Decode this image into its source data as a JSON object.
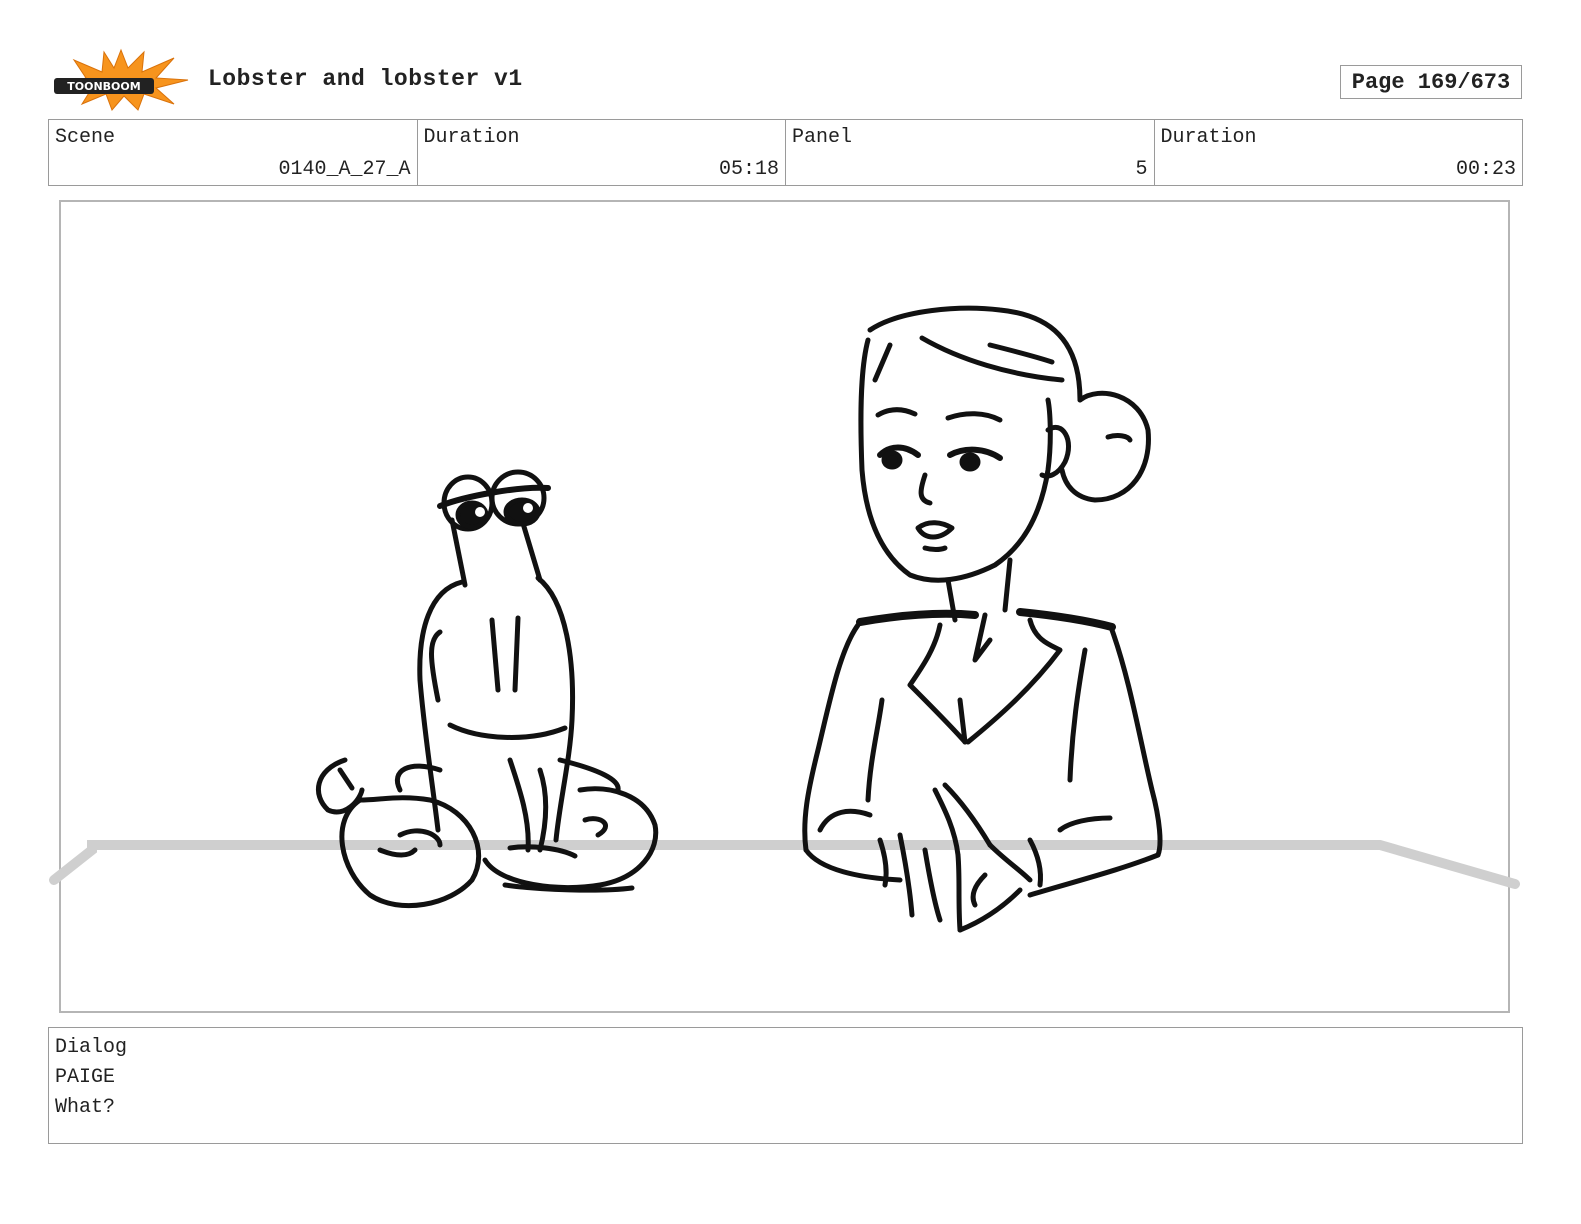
{
  "header": {
    "logo": {
      "icon": "toonboom-logo-icon",
      "text": "TOONBOOM",
      "burst_color": "#f7941d"
    },
    "project_title": "Lobster and lobster v1",
    "page": "Page 169/673"
  },
  "info": {
    "scene_label": "Scene",
    "scene_value": "0140_A_27_A",
    "scene_duration_label": "Duration",
    "scene_duration_value": "05:18",
    "panel_label": "Panel",
    "panel_value": "5",
    "panel_duration_label": "Duration",
    "panel_duration_value": "00:23"
  },
  "panel": {
    "image": "storyboard-sketch-lobster-and-woman-at-desk"
  },
  "dialog": {
    "label": "Dialog",
    "speaker": "PAIGE",
    "line": "What?"
  }
}
